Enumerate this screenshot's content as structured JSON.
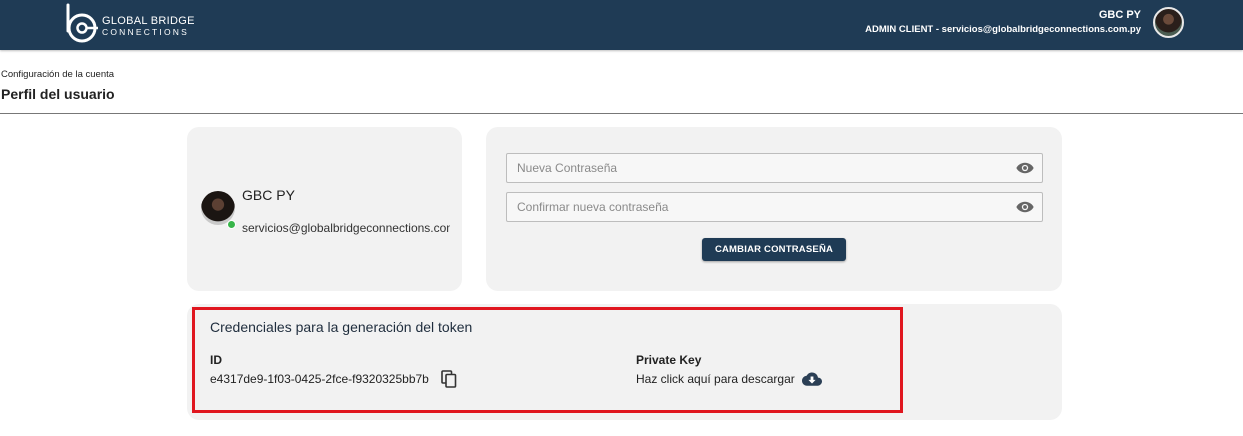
{
  "header": {
    "logo_name": "GLOBAL BRIDGE",
    "logo_sub": "CONNECTIONS",
    "user_name": "GBC PY",
    "user_role_email": "ADMIN CLIENT - servicios@globalbridgeconnections.com.py"
  },
  "page": {
    "breadcrumb": "Configuración de la cuenta",
    "title": "Perfil del usuario"
  },
  "profile": {
    "name": "GBC PY",
    "email": "servicios@globalbridgeconnections.com.py",
    "status": "online"
  },
  "password": {
    "new_placeholder": "Nueva Contraseña",
    "confirm_placeholder": "Confirmar nueva contraseña",
    "submit_label": "CAMBIAR CONTRASEÑA"
  },
  "credentials": {
    "title": "Credenciales para la generación del token",
    "id_label": "ID",
    "id_value": "e4317de9-1f03-0425-2fce-f9320325bb7b",
    "private_key_label": "Private Key",
    "private_key_link": "Haz click aquí para descargar"
  },
  "icons": {
    "logo": "gbc-logo-icon",
    "password_toggle": "eye-icon",
    "copy": "copy-icon",
    "download": "cloud-download-icon"
  },
  "colors": {
    "navbar": "#1f3b55",
    "card": "#f2f2f2",
    "highlight": "#e0161f",
    "online": "#38b54a"
  }
}
